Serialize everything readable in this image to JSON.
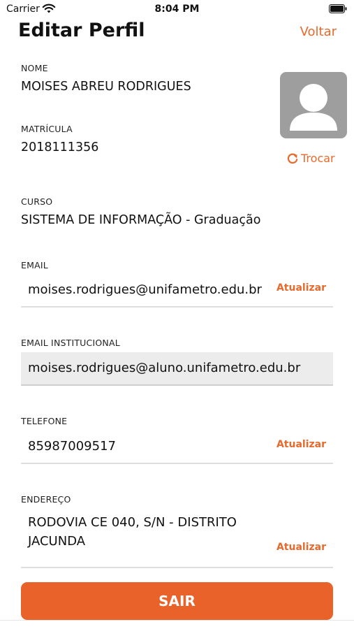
{
  "status_bar": {
    "carrier": "Carrier",
    "time": "8:04 PM"
  },
  "header": {
    "title": "Editar Perfil",
    "back": "Voltar"
  },
  "profile": {
    "nome_label": "NOME",
    "nome": "MOISES ABREU RODRIGUES",
    "matricula_label": "MATRÍCULA",
    "matricula": "2018111356",
    "change_photo": "Trocar",
    "curso_label": "CURSO",
    "curso": "SISTEMA DE INFORMAÇÃO - Graduação"
  },
  "email": {
    "label": "EMAIL",
    "value": "moises.rodrigues@unifametro.edu.br",
    "action": "Atualizar"
  },
  "email_institucional": {
    "label": "EMAIL INSTITUCIONAL",
    "value": "moises.rodrigues@aluno.unifametro.edu.br"
  },
  "telefone": {
    "label": "TELEFONE",
    "value": "85987009517",
    "action": "Atualizar"
  },
  "endereco": {
    "label": "ENDEREÇO",
    "line1": "RODOVIA CE 040, S/N - DISTRITO",
    "line2": "JACUNDA",
    "action": "Atualizar"
  },
  "logout": {
    "label": "SAIR"
  },
  "colors": {
    "accent": "#e8692c",
    "button": "#e8622a",
    "avatar_bg": "#9e9e9e",
    "disabled_bg": "#ececec"
  },
  "icons": {
    "wifi": "wifi-icon",
    "battery": "battery-icon",
    "avatar": "user-silhouette-icon",
    "refresh": "refresh-icon"
  }
}
